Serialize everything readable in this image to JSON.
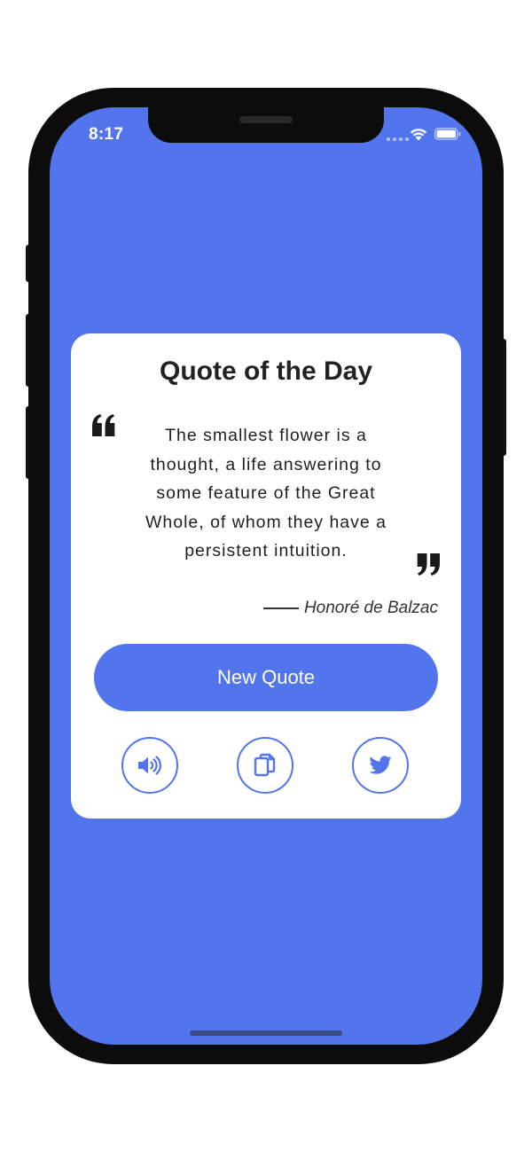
{
  "status_bar": {
    "time": "8:17"
  },
  "card": {
    "title": "Quote of the Day",
    "quote": "The smallest flower is a thought, a life answering to some feature of the Great Whole, of whom they have a persistent intuition.",
    "author": "Honoré de Balzac"
  },
  "actions": {
    "new_quote_label": "New Quote",
    "icons": [
      "speaker-icon",
      "copy-icon",
      "twitter-icon"
    ]
  },
  "colors": {
    "background": "#5275ee",
    "accent": "#5275ee",
    "card": "#ffffff"
  }
}
